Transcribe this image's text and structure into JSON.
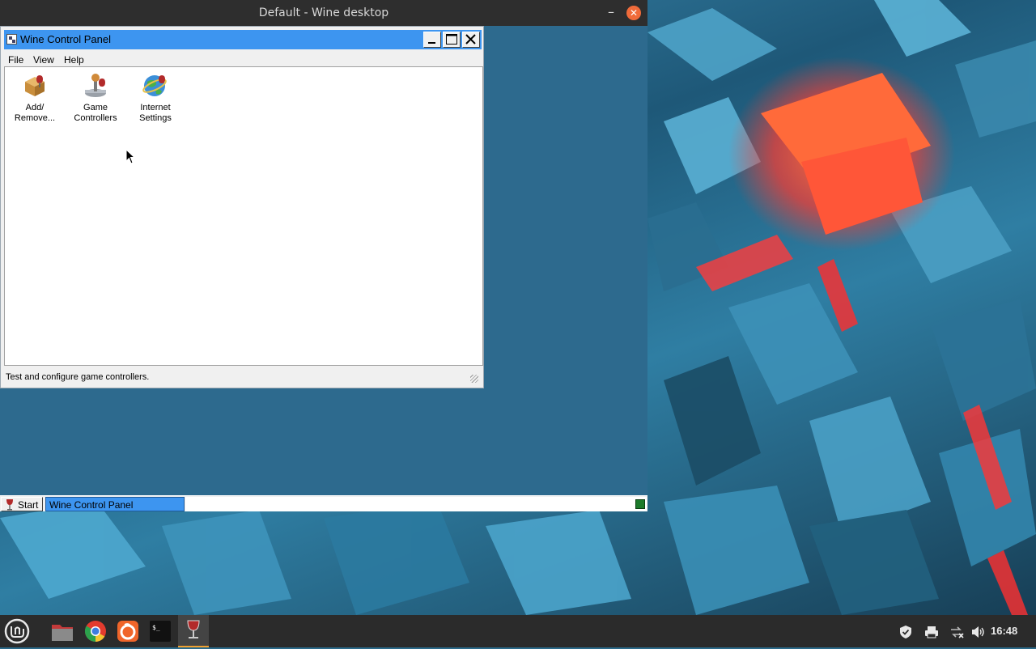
{
  "desktop_window": {
    "title": "Default - Wine desktop",
    "minimize_glyph": "–",
    "close_glyph": "✕"
  },
  "control_panel": {
    "title": "Wine Control Panel",
    "menu": [
      "File",
      "View",
      "Help"
    ],
    "applets": [
      {
        "label_line1": "Add/",
        "label_line2": "Remove...",
        "icon": "add-remove-icon"
      },
      {
        "label_line1": "Game",
        "label_line2": "Controllers",
        "icon": "joystick-icon"
      },
      {
        "label_line1": "Internet",
        "label_line2": "Settings",
        "icon": "internet-globe-icon"
      }
    ],
    "status_text": "Test and configure game controllers."
  },
  "wine_taskbar": {
    "start_label": "Start",
    "tasks": [
      "Wine Control Panel"
    ]
  },
  "panel": {
    "clock": "16:48",
    "launchers": [
      "mint-menu-icon",
      "files-icon",
      "chrome-icon",
      "firefox-icon",
      "terminal-icon",
      "wine-icon"
    ],
    "tray": [
      "shield-icon",
      "printer-icon",
      "network-icon",
      "volume-icon"
    ]
  },
  "colors": {
    "titlebar_active": "#3d95f0",
    "desktop_bg": "#2d6a8e",
    "panel_bg": "#2b2b2b",
    "accent_orange": "#f06b3a"
  }
}
